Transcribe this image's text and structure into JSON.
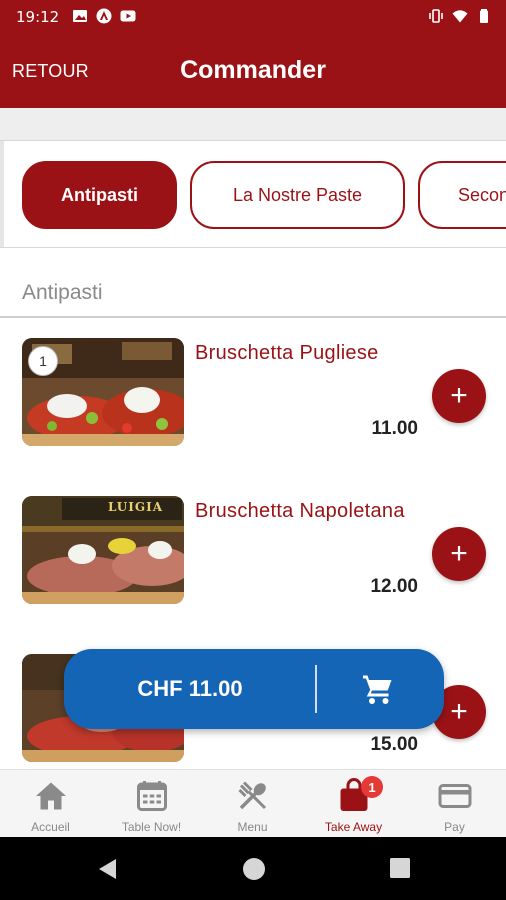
{
  "status_bar": {
    "time": "19:12",
    "icons_left": [
      "image-icon",
      "android-icon",
      "youtube-icon"
    ],
    "icons_right": [
      "vibrate-icon",
      "wifi-icon",
      "battery-icon"
    ]
  },
  "app_bar": {
    "back_label": "RETOUR",
    "title": "Commander"
  },
  "categories": [
    {
      "label": "Antipasti",
      "active": true
    },
    {
      "label": "La Nostre Paste",
      "active": false
    },
    {
      "label": "Secon",
      "active": false
    }
  ],
  "section": {
    "title": "Antipasti"
  },
  "items": [
    {
      "name": "Bruschetta Pugliese",
      "price": "11.00",
      "quantity_badge": "1"
    },
    {
      "name": "Bruschetta Napoletana",
      "price": "12.00",
      "photo_sign": "LUIGIA"
    },
    {
      "name": "",
      "price": "15.00"
    }
  ],
  "add_label": "+",
  "cart": {
    "total": "CHF 11.00",
    "icon": "cart-icon"
  },
  "bottom_nav": [
    {
      "label": "Accueil",
      "icon": "home-icon",
      "active": false
    },
    {
      "label": "Table Now!",
      "icon": "calendar-icon",
      "active": false
    },
    {
      "label": "Menu",
      "icon": "fork-spoon-icon",
      "active": false
    },
    {
      "label": "Take Away",
      "icon": "shopping-bag-icon",
      "active": true,
      "badge": "1"
    },
    {
      "label": "Pay",
      "icon": "credit-card-icon",
      "active": false
    }
  ],
  "colors": {
    "brand": "#9b1216",
    "cart": "#1565b6",
    "badge": "#e53935"
  }
}
